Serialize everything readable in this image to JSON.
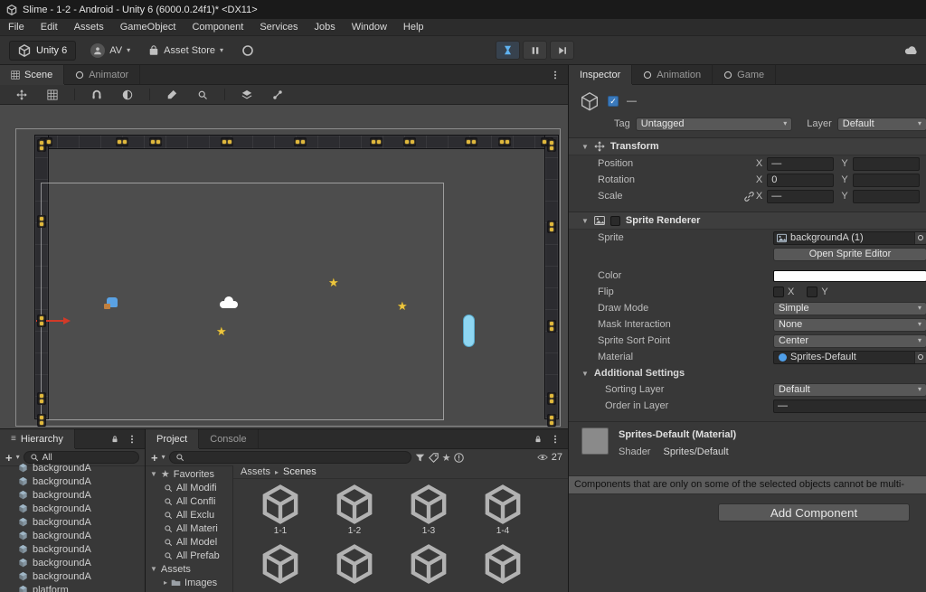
{
  "title_bar": {
    "title": "Slime - 1-2 - Android - Unity 6 (6000.0.24f1)* <DX11>"
  },
  "menu_bar": {
    "items": [
      "File",
      "Edit",
      "Assets",
      "GameObject",
      "Component",
      "Services",
      "Jobs",
      "Window",
      "Help"
    ]
  },
  "toolbar": {
    "unity_badge": "Unity 6",
    "account_label": "AV",
    "asset_store_label": "Asset Store"
  },
  "scene_panel": {
    "tabs": {
      "scene": "Scene",
      "animator": "Animator"
    }
  },
  "hierarchy": {
    "tab": "Hierarchy",
    "search_value": "All",
    "items": [
      "backgroundA",
      "backgroundA",
      "backgroundA",
      "backgroundA",
      "backgroundA",
      "backgroundA",
      "backgroundA",
      "backgroundA",
      "backgroundA",
      "platform"
    ]
  },
  "project": {
    "tab": "Project",
    "console_tab": "Console",
    "favorites_label": "Favorites",
    "favorites": [
      "All Modifi",
      "All Confli",
      "All Exclu",
      "All Materi",
      "All Model",
      "All Prefab"
    ],
    "assets_label": "Assets",
    "assets_children": [
      "Images"
    ],
    "breadcrumb": {
      "root": "Assets",
      "current": "Scenes"
    },
    "hidden_count": "27",
    "grid": [
      {
        "label": "1-1"
      },
      {
        "label": "1-2"
      },
      {
        "label": "1-3"
      },
      {
        "label": "1-4"
      },
      {
        "label": ""
      },
      {
        "label": ""
      },
      {
        "label": ""
      },
      {
        "label": ""
      }
    ]
  },
  "inspector": {
    "tabs": {
      "inspector": "Inspector",
      "animation": "Animation",
      "game": "Game"
    },
    "header": {
      "name_value": "—",
      "tag_label": "Tag",
      "tag_value": "Untagged",
      "layer_label": "Layer",
      "layer_value": "Default"
    },
    "transform": {
      "title": "Transform",
      "x_label": "X",
      "y_label": "Y",
      "position_label": "Position",
      "position_x": "—",
      "rotation_label": "Rotation",
      "rotation_x": "0",
      "scale_label": "Scale",
      "scale_x": "—"
    },
    "sprite_renderer": {
      "title": "Sprite Renderer",
      "sprite_label": "Sprite",
      "sprite_value": "backgroundA (1)",
      "open_sprite_editor": "Open Sprite Editor",
      "color_label": "Color",
      "flip_label": "Flip",
      "flip_x_label": "X",
      "flip_y_label": "Y",
      "draw_mode_label": "Draw Mode",
      "draw_mode_value": "Simple",
      "mask_label": "Mask Interaction",
      "mask_value": "None",
      "sort_point_label": "Sprite Sort Point",
      "sort_point_value": "Center",
      "material_label": "Material",
      "material_value": "Sprites-Default",
      "additional_label": "Additional Settings",
      "sorting_layer_label": "Sorting Layer",
      "sorting_layer_value": "Default",
      "order_label": "Order in Layer",
      "order_value": "—"
    },
    "material_section": {
      "title": "Sprites-Default (Material)",
      "shader_label": "Shader",
      "shader_value": "Sprites/Default"
    },
    "note": "Components that are only on some of the selected objects cannot be multi-",
    "add_component_label": "Add Component"
  },
  "colors": {
    "accent_blue": "#4f9ee8",
    "star_yellow": "#ecc53e",
    "panel_bg": "#383838"
  }
}
